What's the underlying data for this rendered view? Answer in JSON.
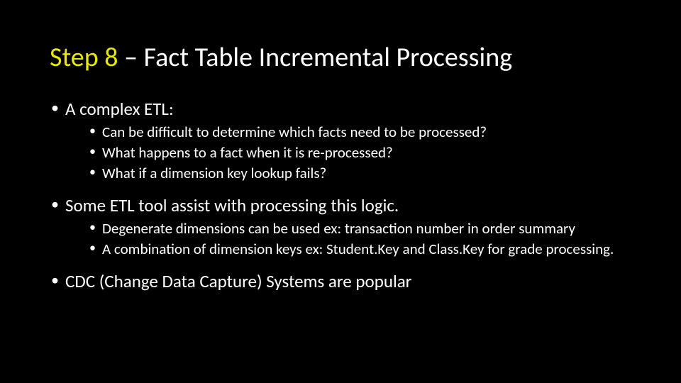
{
  "title": {
    "accent": "Step 8",
    "rest": " – Fact Table Incremental Processing"
  },
  "bullets": [
    {
      "text": "A complex ETL:",
      "sub": [
        "Can be difficult to determine which facts need to be processed?",
        "What happens to a fact when it is re-processed?",
        "What if a dimension key lookup fails?"
      ]
    },
    {
      "text": "Some ETL tool assist with processing this logic.",
      "sub": [
        "Degenerate dimensions can be used ex: transaction number in order summary",
        "A combination of dimension keys ex: Student.Key and Class.Key for grade processing."
      ]
    },
    {
      "text": "CDC (Change Data Capture) Systems are popular",
      "sub": []
    }
  ]
}
